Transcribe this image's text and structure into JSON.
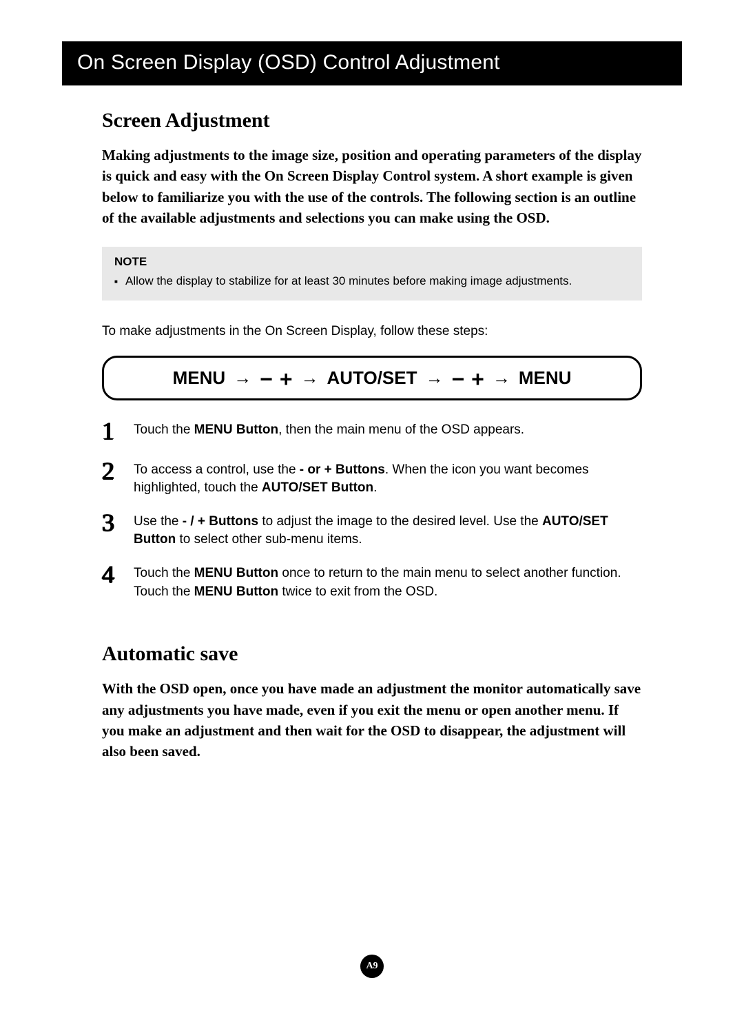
{
  "header": {
    "title": "On Screen Display (OSD) Control Adjustment"
  },
  "section1": {
    "heading": "Screen Adjustment",
    "intro": "Making adjustments to the image size, position and operating parameters of the display is quick and easy with the On Screen Display Control system. A short example is given below to familiarize you with the use of the controls. The following section is an outline of the available adjustments and selections you can make using the OSD."
  },
  "note": {
    "label": "NOTE",
    "items": [
      "Allow the display to stabilize for at least 30 minutes before making image adjustments."
    ]
  },
  "lead": "To make adjustments in the On Screen Display, follow these steps:",
  "sequence": {
    "t1": "MENU",
    "t2": "AUTO/SET",
    "t3": "MENU",
    "arrow": "→",
    "minus": "−",
    "plus": "+"
  },
  "steps": [
    {
      "num": "1",
      "pre": "Touch the ",
      "b1": "MENU Button",
      "post": ", then the main menu of the OSD appears."
    },
    {
      "num": "2",
      "pre": "To access a control, use the   ",
      "b1": "- or  + Buttons",
      "mid": ". When the icon you want becomes highlighted, touch the ",
      "b2": "AUTO/SET Button",
      "post": "."
    },
    {
      "num": "3",
      "pre": " Use the  ",
      "b1": "-  / +  Buttons",
      "mid": " to adjust the image to the desired level. Use the ",
      "b2": "AUTO/SET Button",
      "post": " to select other sub-menu items."
    },
    {
      "num": "4",
      "pre": "Touch the ",
      "b1": "MENU Button",
      "mid": " once to return to the main menu to select another function. Touch the ",
      "b2": "MENU Button",
      "post": " twice to exit from the OSD."
    }
  ],
  "section2": {
    "heading": "Automatic save",
    "intro": "With the OSD open, once you have made an adjustment the monitor automatically save any adjustments you have made, even if you exit the menu or open another menu. If you make an adjustment and then wait for the OSD to disappear, the adjustment will also been saved."
  },
  "page": "A9"
}
